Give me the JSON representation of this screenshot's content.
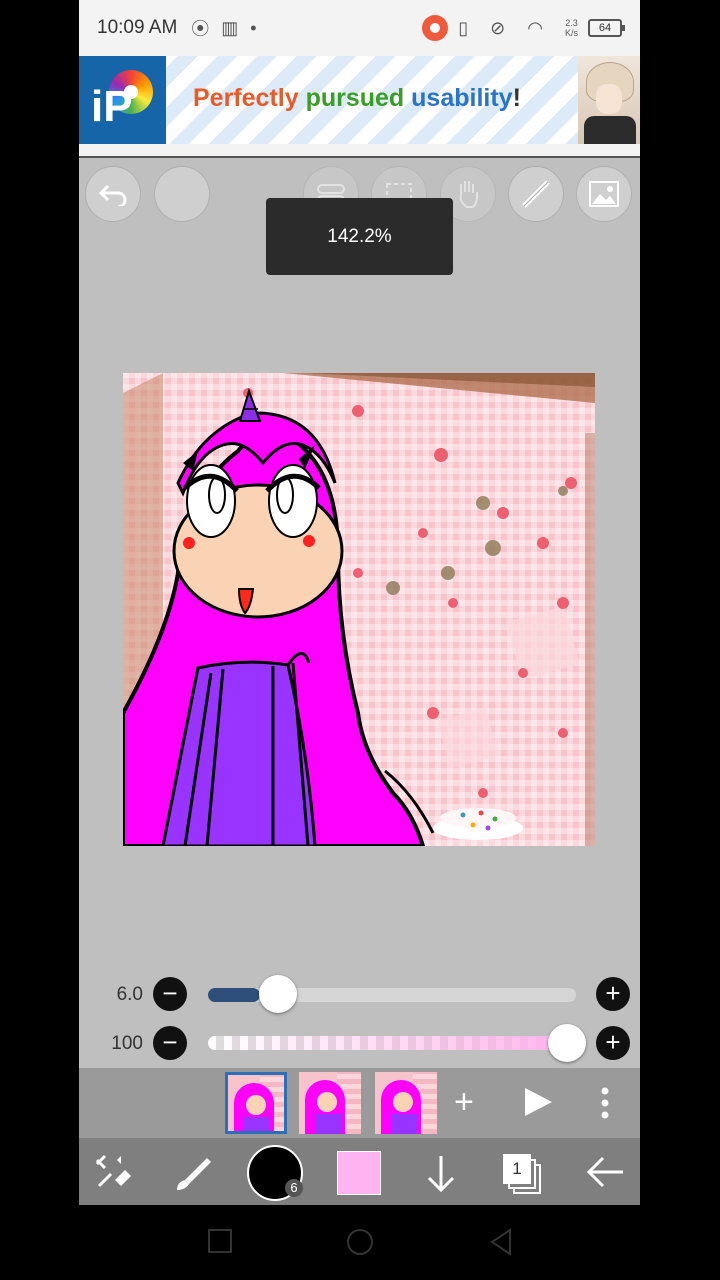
{
  "status": {
    "time": "10:09 AM",
    "speed_value": "2.3",
    "speed_unit": "K/s",
    "battery": "64"
  },
  "ad": {
    "brand": "iP",
    "slogan_1": "Perfectly",
    "slogan_2": "pursued",
    "slogan_3": "usability",
    "slogan_4": "!"
  },
  "toolbar": {
    "zoom_label": "142.2%",
    "undo_icon": "undo-icon",
    "redo_icon": "redo-icon",
    "buttons": [
      "toggle-icon",
      "selection-icon",
      "hand-icon",
      "ruler-icon",
      "image-icon"
    ]
  },
  "brush": {
    "size_label": "6.0",
    "size_level": 0.14,
    "opacity_label": "100",
    "opacity_level": 1.0
  },
  "frames": {
    "count": 3,
    "selected_index": 0,
    "add_label": "+",
    "play_icon": "play-icon",
    "more_icon": "more-vertical-icon"
  },
  "bottom": {
    "brush_size_badge": "6",
    "layer_count": "1",
    "primary_color": "#000000",
    "secondary_color": "#ffb3ef"
  },
  "colors": {
    "accent_blue": "#2d4f7a",
    "pink_bg": "#f7c4cc",
    "magenta": "#ff00ff",
    "purple": "#9933ff"
  }
}
